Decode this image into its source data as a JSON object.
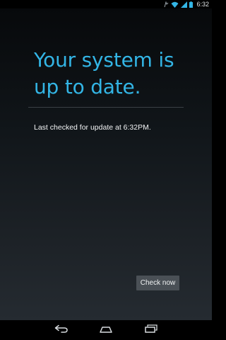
{
  "status_bar": {
    "time": "6:32",
    "icons": [
      "notification-icon",
      "wifi-icon",
      "signal-icon",
      "battery-icon"
    ]
  },
  "main": {
    "headline": "Your system is up to date.",
    "last_checked": "Last checked for update at 6:32PM.",
    "check_button_label": "Check now"
  },
  "nav_bar": {
    "buttons": [
      "back",
      "home",
      "recent-apps"
    ]
  },
  "colors": {
    "accent": "#33b5e5",
    "button_bg": "#4a5056",
    "text": "#f2f4f5"
  }
}
